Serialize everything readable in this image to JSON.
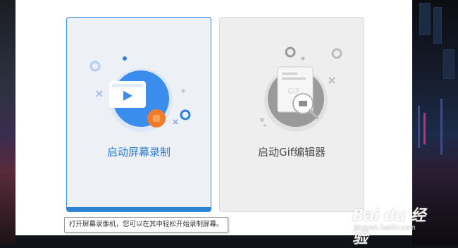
{
  "cards": {
    "record": {
      "label": "启动屏幕录制",
      "icon": "video-camera-icon"
    },
    "gif": {
      "label": "启动Gif编辑器",
      "icon": "gif-editor-icon"
    }
  },
  "tooltip": {
    "text": "打开屏幕录像机，您可以在其中轻松开始录制屏幕。"
  },
  "watermark": {
    "main": "Bai du 经验",
    "sub": "jingyan.baidu.com"
  },
  "colors": {
    "accent_blue": "#2b84d3",
    "record_dot": "#f07b2a",
    "card_selected_bg": "#edf0f5",
    "card_bg": "#eeeeef"
  }
}
